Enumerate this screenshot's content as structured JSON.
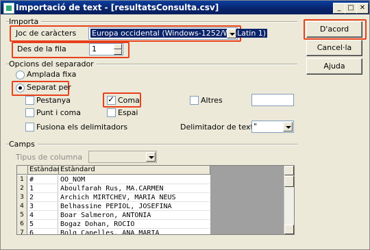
{
  "window": {
    "title": "Importació de text - [resultatsConsulta.csv]"
  },
  "title_buttons": {
    "minimize": "_",
    "maximize": "□",
    "close": "✕"
  },
  "import": {
    "section": "Importa",
    "charset_label": "Joc de caràcters",
    "charset_value": "Europa occidental (Windows-1252/WinLatin 1)",
    "from_row_label": "Des de la fila",
    "from_row_value": "1"
  },
  "separator": {
    "section": "Opcions del separador",
    "fixed_width": "Amplada fixa",
    "separated_by": "Separat per",
    "tab": "Pestanya",
    "comma": "Coma",
    "others": "Altres",
    "semicolon": "Punt i coma",
    "space": "Espai",
    "merge_delims": "Fusiona els delimitadors",
    "text_delim_label": "Delimitador de text",
    "text_delim_value": "\""
  },
  "fields": {
    "section": "Camps",
    "column_type_label": "Tipus de columna",
    "headers": [
      "Estàndard",
      "Estàndard"
    ],
    "rows": [
      {
        "n": "1",
        "c1": "#",
        "c2": "OO_NOM"
      },
      {
        "n": "2",
        "c1": "1",
        "c2": "Aboulfarah Rus, MA.CARMEN"
      },
      {
        "n": "3",
        "c1": "2",
        "c2": "Archich MIRTCHEV, MARIA NEUS"
      },
      {
        "n": "4",
        "c1": "3",
        "c2": "Belhassine PEPIOL, JOSEFINA"
      },
      {
        "n": "5",
        "c1": "4",
        "c2": "Boar Salmeron, ANTONIA"
      },
      {
        "n": "6",
        "c1": "5",
        "c2": "Bogaz Dohan, ROCIO"
      },
      {
        "n": "7",
        "c1": "6",
        "c2": "Bolg Capelles, ANA MARIA"
      }
    ]
  },
  "buttons": {
    "ok": "D'acord",
    "cancel": "Cancel·la",
    "help": "Ajuda"
  },
  "colors": {
    "highlight": "#e8401c",
    "title_bar": "#0a246a",
    "dialog_bg": "#ece9d8"
  }
}
